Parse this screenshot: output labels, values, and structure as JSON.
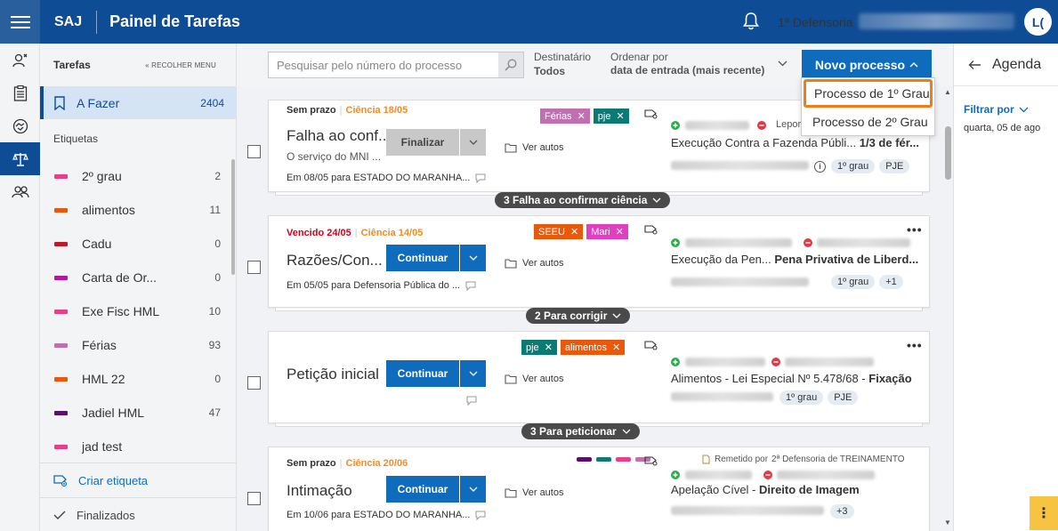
{
  "header": {
    "brand": "SAJ",
    "title": "Painel de Tarefas",
    "defensoria": "1ª Defensoria",
    "avatar_initials": "L("
  },
  "sidebar": {
    "title": "Tarefas",
    "collapse_label": "RECOLHER MENU",
    "afazer": {
      "label": "A Fazer",
      "count": "2404"
    },
    "etiquetas_title": "Etiquetas",
    "tags": [
      {
        "name": "2º grau",
        "count": "2",
        "color": "#e83e8c"
      },
      {
        "name": "alimentos",
        "count": "11",
        "color": "#e8590c"
      },
      {
        "name": "Cadu",
        "count": "0",
        "color": "#c0182f"
      },
      {
        "name": "Carta de Or...",
        "count": "0",
        "color": "#b5179e"
      },
      {
        "name": "Exe Fisc HML",
        "count": "10",
        "color": "#e83e8c"
      },
      {
        "name": "Férias",
        "count": "93",
        "color": "#c06fb0"
      },
      {
        "name": "HML 22",
        "count": "0",
        "color": "#e8590c"
      },
      {
        "name": "Jadiel HML",
        "count": "47",
        "color": "#5c0e6e"
      },
      {
        "name": "jad test",
        "count": "",
        "color": "#e83e8c"
      }
    ],
    "criar_label": "Criar etiqueta",
    "finalizados_label": "Finalizados"
  },
  "toolbar": {
    "search_placeholder": "Pesquisar pelo número do processo",
    "dest_label": "Destinatário",
    "dest_value": "Todos",
    "ord_label": "Ordenar por",
    "ord_value": "data de entrada (mais recente)",
    "novo_label": "Novo processo"
  },
  "dropdown": {
    "items": [
      "Processo de 1º Grau",
      "Processo de 2º Grau"
    ]
  },
  "cards": [
    {
      "prazo": "Sem prazo",
      "ciencia": "Ciência 18/05",
      "title": "Falha ao conf...",
      "subtitle": "O serviço do MNI ...",
      "foot": "Em 08/05 para ESTADO DO MARANHA...",
      "button": "Finalizar",
      "ver_autos": "Ver autos",
      "tags": [
        {
          "label": "Férias",
          "color": "#c06fb0"
        },
        {
          "label": "pje",
          "color": "#0b7a75"
        }
      ],
      "party": "Leporis",
      "acao": "Execução Contra a Fazenda Públi...",
      "acao_bold": "1/3 de fér...",
      "badges": [
        "1º grau",
        "PJE"
      ],
      "group": "3 Falha ao confirmar ciência"
    },
    {
      "prazo": "Vencido 24/05",
      "ciencia": "Ciência 14/05",
      "title": "Razões/Con...",
      "foot": "Em 05/05 para Defensoria Pública do ...",
      "button": "Continuar",
      "ver_autos": "Ver autos",
      "tags": [
        {
          "label": "SEEU",
          "color": "#e8590c"
        },
        {
          "label": "Mari",
          "color": "#e040c0"
        }
      ],
      "acao": "Execução da Pen...",
      "acao_bold": "Pena Privativa de Liberd...",
      "badges": [
        "1º grau",
        "+1"
      ],
      "group": "2 Para corrigir"
    },
    {
      "title": "Petição inicial",
      "button": "Continuar",
      "ver_autos": "Ver autos",
      "tags": [
        {
          "label": "pje",
          "color": "#0b7a75"
        },
        {
          "label": "alimentos",
          "color": "#e8590c"
        }
      ],
      "acao": "Alimentos - Lei Especial Nº 5.478/68 -",
      "acao_bold": "Fixação",
      "badges": [
        "1º grau",
        "PJE"
      ],
      "group": "3 Para peticionar"
    },
    {
      "prazo": "Sem prazo",
      "ciencia": "Ciência 20/06",
      "title": "Intimação",
      "foot": "Em 10/06 para ESTADO DO MARANHA...",
      "button": "Continuar",
      "ver_autos": "Ver autos",
      "remetido": "Remetido por",
      "remetido_dest": "2ª Defensoria de TREINAMENTO",
      "dot_colors": [
        "#5c0e6e",
        "#0b7a75",
        "#e83e8c",
        "#c06fb0"
      ],
      "acao": "Apelação Cível -",
      "acao_bold": "Direito de Imagem",
      "badges": [
        "+3"
      ]
    }
  ],
  "agenda": {
    "title": "Agenda",
    "filter_label": "Filtrar por",
    "date": "quarta, 05 de ago"
  },
  "colors": {
    "primary": "#0f4c96",
    "button": "#0f6cbd",
    "highlight": "#f07c1a",
    "ciencia": "#f28c28",
    "vencido": "#d0021b"
  }
}
